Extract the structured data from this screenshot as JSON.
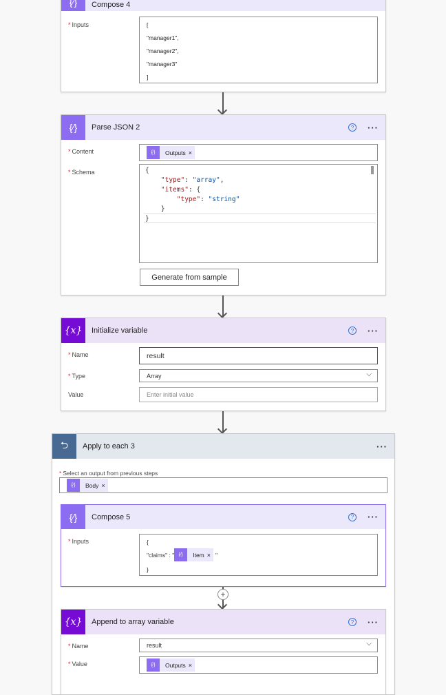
{
  "compose4": {
    "title": "Compose 4",
    "inputs_label": "Inputs",
    "lines": [
      "[",
      "\"manager1\",",
      "\"manager2\",",
      "\"manager3\"",
      "]"
    ]
  },
  "parse": {
    "title": "Parse JSON 2",
    "content_label": "Content",
    "content_token": "Outputs",
    "schema_label": "Schema",
    "schema": {
      "l1": "{",
      "k1": "\"type\"",
      "v1": "\"array\"",
      "k2": "\"items\"",
      "k3": "\"type\"",
      "v3": "\"string\"",
      "l5": "}",
      "l6": "}"
    },
    "generate_label": "Generate from sample"
  },
  "initvar": {
    "title": "Initialize variable",
    "name_label": "Name",
    "name_value": "result",
    "type_label": "Type",
    "type_value": "Array",
    "value_label": "Value",
    "value_placeholder": "Enter initial value"
  },
  "apply": {
    "title": "Apply to each 3",
    "select_label": "Select an output from previous steps",
    "token": "Body"
  },
  "compose5": {
    "title": "Compose 5",
    "inputs_label": "Inputs",
    "open": "{",
    "claims_prefix": "\"claims\" : \"",
    "token": "Item",
    "claims_suffix": "\"",
    "close": "}"
  },
  "append": {
    "title": "Append to array variable",
    "name_label": "Name",
    "name_value": "result",
    "value_label": "Value",
    "value_token": "Outputs"
  },
  "colors": {
    "compose": "#8c6cf0",
    "variable": "#770bd6",
    "loop": "#486991"
  }
}
